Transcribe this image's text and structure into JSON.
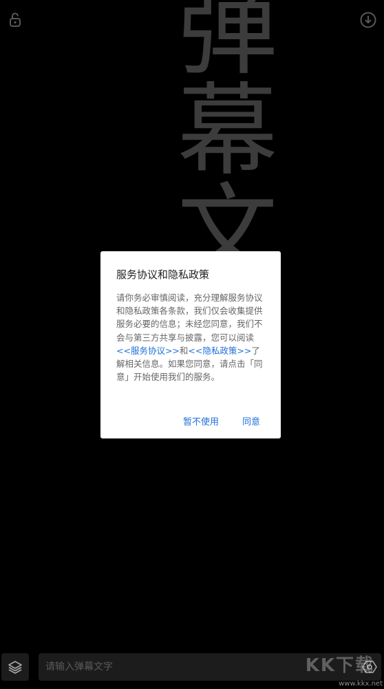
{
  "marquee": {
    "text": "弹幕文字"
  },
  "top_bar": {
    "lock_icon": "unlock-icon",
    "download_icon": "download-circle-icon"
  },
  "dialog": {
    "title": "服务协议和隐私政策",
    "body_part1": "请你务必审慎阅读，充分理解服务协议和隐私政策各条款，我们仅会收集提供服务必要的信息；未经您同意，我们不会与第三方共享与披露，您可以阅读",
    "service_link": "<<服务协议>>",
    "and_text": "和",
    "privacy_link": "<<隐私政策>>",
    "body_part2": "了解相关信息。如果您同意，请点击「同意」开始使用我们的服务。",
    "decline_label": "暂不使用",
    "agree_label": "同意"
  },
  "bottom_bar": {
    "layers_icon": "layers-icon",
    "input_placeholder": "请输入弹幕文字",
    "send_icon": "send-settings-icon"
  },
  "watermark": {
    "logo": "KK下载",
    "url": "www.kkx.net"
  },
  "colors": {
    "background": "#000000",
    "marquee_text": "#5c5c5c",
    "link": "#1e6fd9",
    "dialog_bg": "#ffffff"
  }
}
